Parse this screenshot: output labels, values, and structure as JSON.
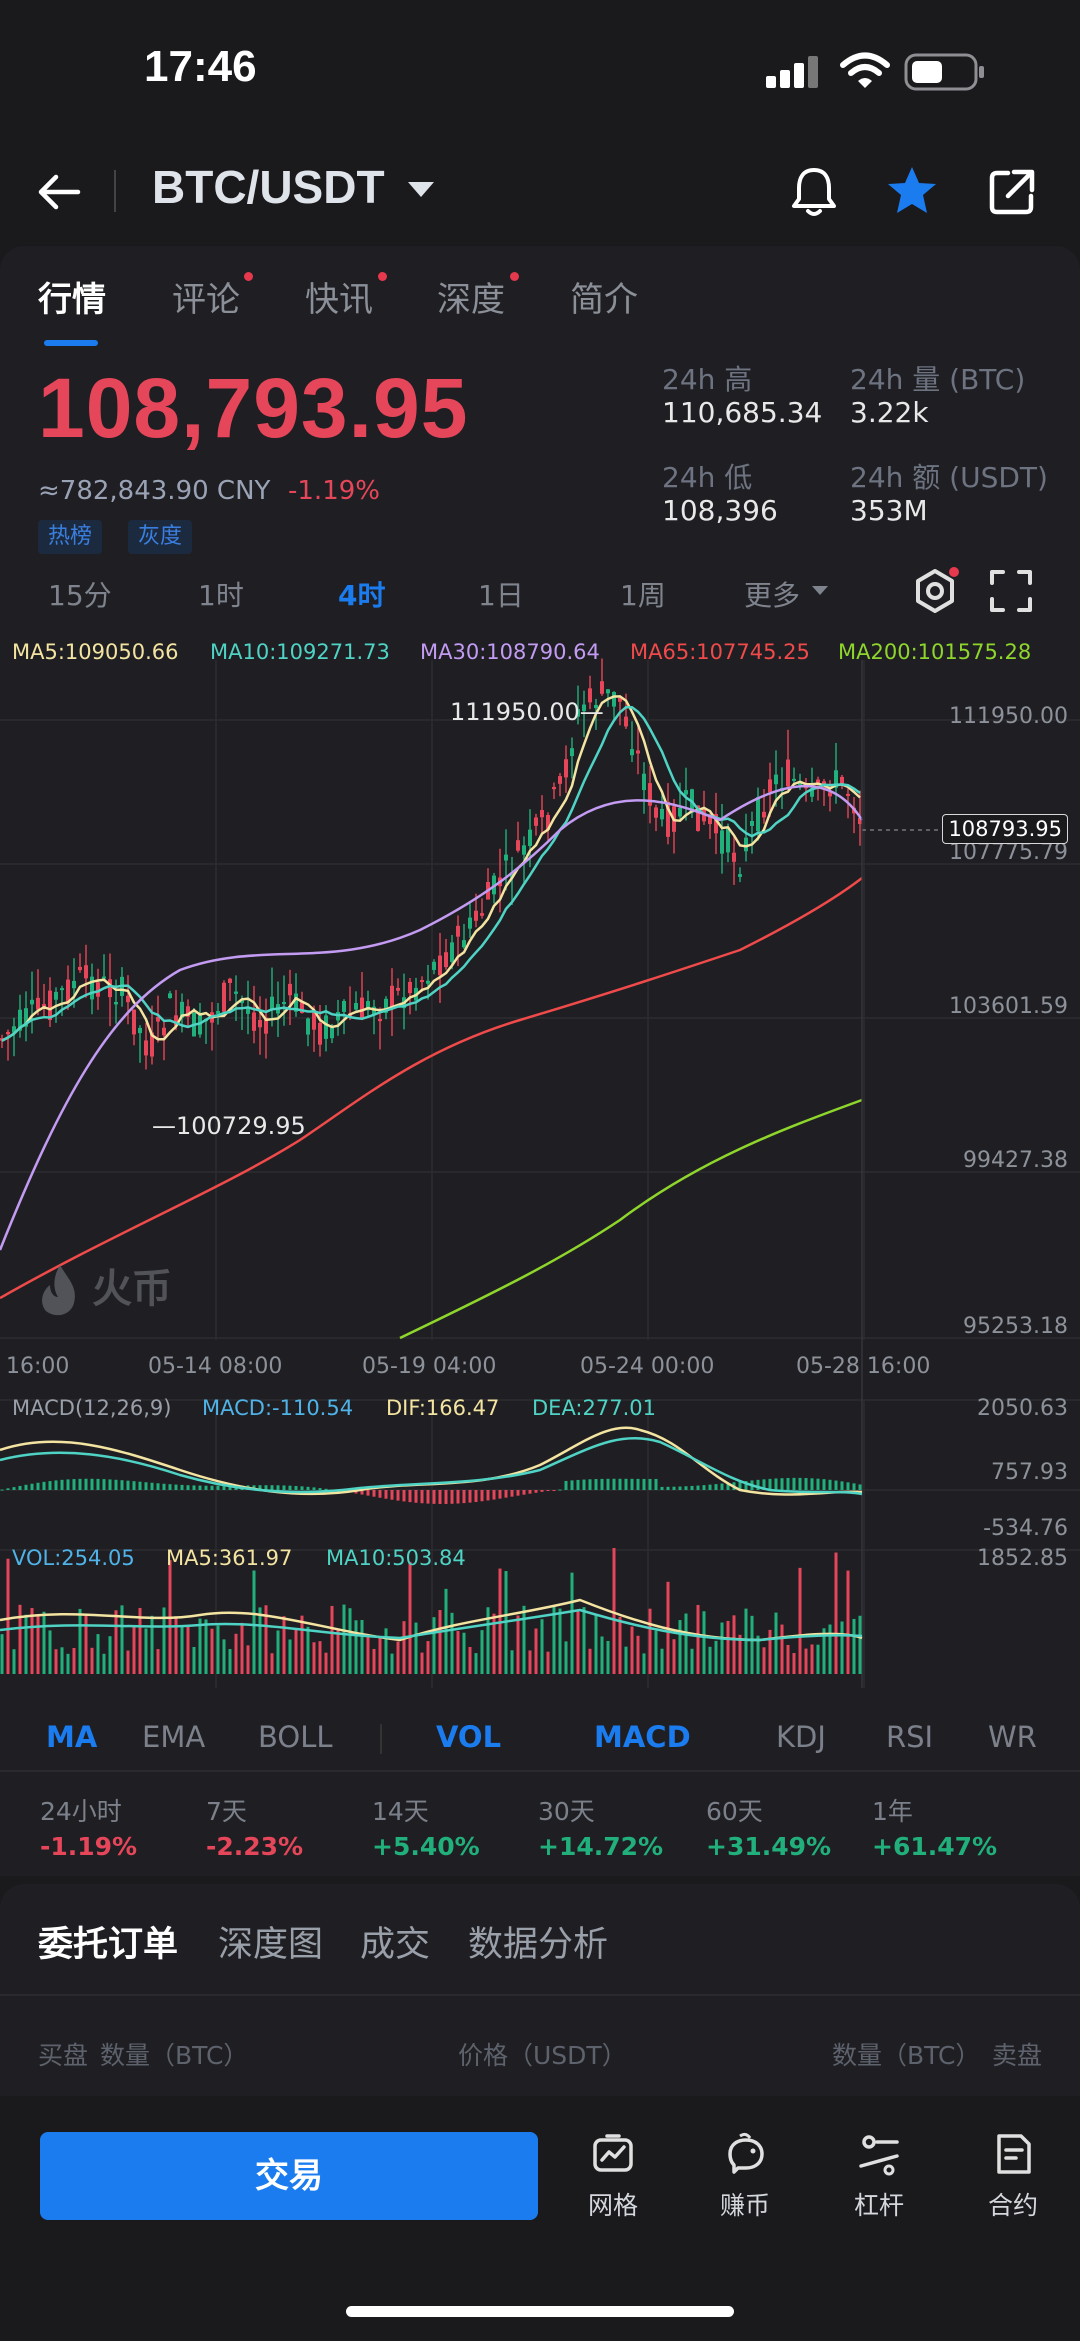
{
  "status_bar": {
    "time": "17:46"
  },
  "header": {
    "pair": "BTC/USDT"
  },
  "tabs": [
    {
      "label": "行情",
      "active": true,
      "dot": false
    },
    {
      "label": "评论",
      "active": false,
      "dot": true
    },
    {
      "label": "快讯",
      "active": false,
      "dot": true
    },
    {
      "label": "深度",
      "active": false,
      "dot": true
    },
    {
      "label": "简介",
      "active": false,
      "dot": false
    }
  ],
  "ticker": {
    "last_price": "108,793.95",
    "cny_price": "≈782,843.90 CNY",
    "change": "-1.19%",
    "tags": [
      "热榜",
      "灰度"
    ],
    "high_label": "24h 高",
    "high_value": "110,685.34",
    "low_label": "24h 低",
    "low_value": "108,396",
    "vol_label": "24h 量 (BTC)",
    "vol_value": "3.22k",
    "amount_label": "24h 额 (USDT)",
    "amount_value": "353M"
  },
  "timeframes": [
    "15分",
    "1时",
    "4时",
    "1日",
    "1周",
    "更多"
  ],
  "active_timeframe": "4时",
  "ma_legend": {
    "ma5": "MA5:109050.66",
    "ma10": "MA10:109271.73",
    "ma30": "MA30:108790.64",
    "ma65": "MA65:107745.25",
    "ma200": "MA200:101575.28"
  },
  "price_axis": [
    "111950.00",
    "107775.79",
    "103601.59",
    "99427.38",
    "95253.18"
  ],
  "current_price_tag": "108793.95",
  "chart_annotations": {
    "high": "111950.00",
    "low": "100729.95"
  },
  "watermark": "火币",
  "time_axis": [
    "16:00",
    "05-14 08:00",
    "05-19 04:00",
    "05-24 00:00",
    "05-28 16:00"
  ],
  "macd": {
    "title": "MACD(12,26,9)",
    "macd": "MACD:-110.54",
    "dif": "DIF:166.47",
    "dea": "DEA:277.01",
    "axis": [
      "2050.63",
      "757.93",
      "-534.76"
    ]
  },
  "volume": {
    "vol": "VOL:254.05",
    "ma5": "MA5:361.97",
    "ma10": "MA10:503.84",
    "axis_top": "1852.85"
  },
  "indicator_tabs": [
    {
      "label": "MA",
      "active": true
    },
    {
      "label": "EMA",
      "active": false
    },
    {
      "label": "BOLL",
      "active": false
    },
    {
      "label": "VOL",
      "active": true
    },
    {
      "label": "MACD",
      "active": true
    },
    {
      "label": "KDJ",
      "active": false
    },
    {
      "label": "RSI",
      "active": false
    },
    {
      "label": "WR",
      "active": false
    }
  ],
  "performance": [
    {
      "label": "24小时",
      "value": "-1.19%",
      "dir": "down"
    },
    {
      "label": "7天",
      "value": "-2.23%",
      "dir": "down"
    },
    {
      "label": "14天",
      "value": "+5.40%",
      "dir": "up"
    },
    {
      "label": "30天",
      "value": "+14.72%",
      "dir": "up"
    },
    {
      "label": "60天",
      "value": "+31.49%",
      "dir": "up"
    },
    {
      "label": "1年",
      "value": "+61.47%",
      "dir": "up"
    }
  ],
  "section_tabs": [
    "委托订单",
    "深度图",
    "成交",
    "数据分析"
  ],
  "orderbook_header": {
    "buy": "买盘",
    "buy_qty": "数量（BTC）",
    "price": "价格（USDT）",
    "sell_qty": "数量（BTC）",
    "sell": "卖盘"
  },
  "bottom_nav": {
    "trade": "交易",
    "grid": "网格",
    "earn": "赚币",
    "leverage": "杠杆",
    "contract": "合约"
  },
  "colors": {
    "up": "#21b07c",
    "down": "#e64659",
    "accent": "#1b7cf0",
    "ma5": "#f4e4a1",
    "ma10": "#4fd3c4",
    "ma30": "#c39bf2",
    "ma65": "#f04a4a",
    "ma200": "#8fd62c"
  }
}
